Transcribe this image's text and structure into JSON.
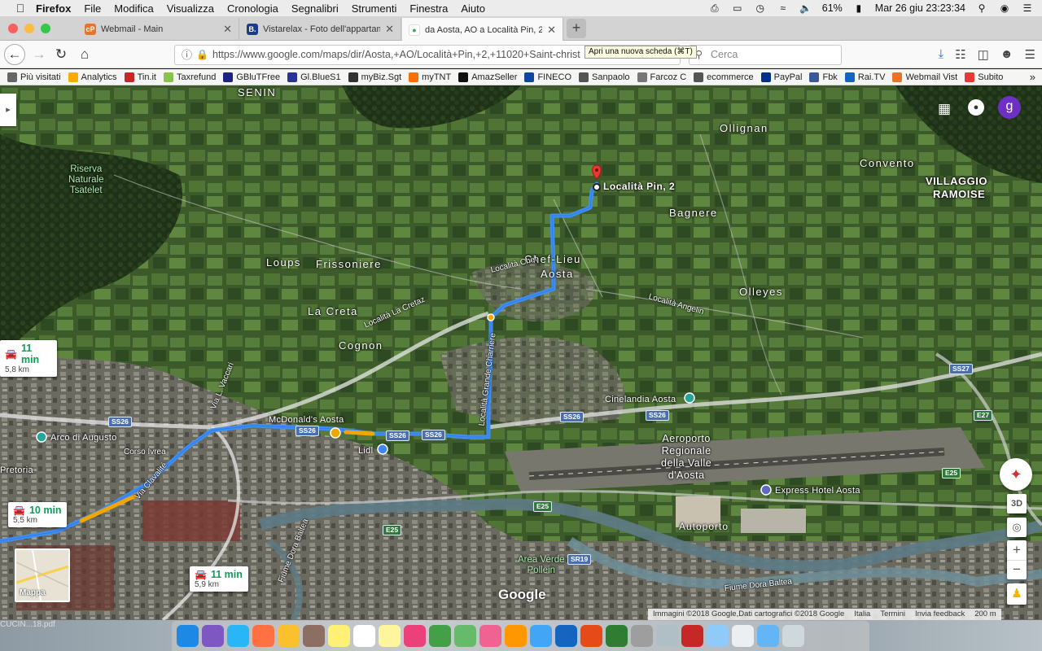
{
  "menubar": {
    "app": "Firefox",
    "items": [
      "File",
      "Modifica",
      "Visualizza",
      "Cronologia",
      "Segnalibri",
      "Strumenti",
      "Finestra",
      "Aiuto"
    ],
    "battery": "61%",
    "datetime": "Mar 26 giu  23:23:34"
  },
  "tabs": [
    {
      "label": "Webmail - Main",
      "favicon": "webmail-icon",
      "color": "#e8742b"
    },
    {
      "label": "Vistarelax - Foto dell'appartame",
      "favicon": "booking-icon",
      "color": "#1b3b8a"
    },
    {
      "label": "da Aosta, AO a Località Pin, 2 -",
      "favicon": "maps-icon",
      "color": "#34a853"
    }
  ],
  "toolbar": {
    "url": "https://www.google.com/maps/dir/Aosta,+AO/Località+Pin,+2,+11020+Saint-christ",
    "tooltip": "Apri una nuova scheda (⌘T)",
    "search_placeholder": "Cerca"
  },
  "bookmarks": [
    {
      "label": "Più visitati",
      "color": "#666"
    },
    {
      "label": "Analytics",
      "color": "#f9ab00"
    },
    {
      "label": "Tin.it",
      "color": "#c62828"
    },
    {
      "label": "Taxrefund",
      "color": "#8bc34a"
    },
    {
      "label": "GBluTFree",
      "color": "#1a237e"
    },
    {
      "label": "Gl.BlueS1",
      "color": "#283593"
    },
    {
      "label": "myBiz.Sgt",
      "color": "#333"
    },
    {
      "label": "myTNT",
      "color": "#ff6f00"
    },
    {
      "label": "AmazSeller",
      "color": "#111"
    },
    {
      "label": "FINECO",
      "color": "#0d47a1"
    },
    {
      "label": "Sanpaolo",
      "color": "#555"
    },
    {
      "label": "Farcoz C",
      "color": "#777"
    },
    {
      "label": "ecommerce",
      "color": "#555"
    },
    {
      "label": "PayPal",
      "color": "#003087"
    },
    {
      "label": "Fbk",
      "color": "#3b5998"
    },
    {
      "label": "Rai.TV",
      "color": "#1565c0"
    },
    {
      "label": "Webmail Vist",
      "color": "#e8742b"
    },
    {
      "label": "Subito",
      "color": "#e53935"
    }
  ],
  "map": {
    "places": [
      "SENIN",
      "Ollignan",
      "Convento",
      "VILLAGGIO",
      "RAMOISE",
      "Bagnere",
      "Loups",
      "Frissoniere",
      "Chef-Lieu",
      "Aosta",
      "Olleyes",
      "La Creta",
      "Cognon",
      "Pretoria"
    ],
    "green_places": [
      "Riserva",
      "Naturale",
      "Tsatelet",
      "Area Verde",
      "Pollein"
    ],
    "pois": [
      "Arco di Augusto",
      "McDonald's Aosta",
      "Lidl",
      "Cinelandia Aosta",
      "Express Hotel Aosta",
      "Autoporto"
    ],
    "airport": [
      "Aeroporto",
      "Regionale",
      "della Valle",
      "d'Aosta"
    ],
    "roads": [
      "Località La Cretaz",
      "Località Chef",
      "Località Angelin",
      "Località Grande Charriere",
      "Via L. Vaccari",
      "Corso Ivrea",
      "Via Clavalité",
      "Fiume Dora Baltea",
      "Fiume Dora Baltea"
    ],
    "shields": [
      "SS26",
      "SS26",
      "SS26",
      "SS26",
      "SS26",
      "SS26",
      "SS27",
      "E27",
      "E25",
      "E25",
      "E25",
      "SR19"
    ],
    "destination": "Località Pin, 2",
    "routes": [
      {
        "time": "11 min",
        "distance": "5,8 km"
      },
      {
        "time": "10 min",
        "distance": "5,5 km"
      },
      {
        "time": "11 min",
        "distance": "5,9 km"
      }
    ],
    "minimap_label": "Mappa",
    "google_logo": "Google",
    "footer": [
      "Immagini ©2018 Google,Dati cartografici ©2018 Google",
      "Italia",
      "Termini",
      "Invia feedback",
      "200 m"
    ],
    "avatar_letter": "g",
    "tilt_label": "3D"
  },
  "desktop": {
    "file_label": "CUCIN...18.pdf"
  },
  "dock": [
    "Finder",
    "Siri",
    "Safari",
    "Firefox",
    "Chrome",
    "Preview",
    "Notes",
    "Calendar",
    "Stickies",
    "Photos",
    "Messages",
    "FaceTime",
    "Music",
    "Books",
    "App Store",
    "Word",
    "PowerPoint",
    "Excel",
    "Scanner",
    "Launcher",
    "DVD Remote",
    "Folder",
    "Document",
    "Downloads",
    "Trash"
  ],
  "colors": {
    "route_main": "#3e8ef7",
    "route_alt": "#c9c9c9",
    "traffic": "#f2a600",
    "pin": "#e53935"
  }
}
